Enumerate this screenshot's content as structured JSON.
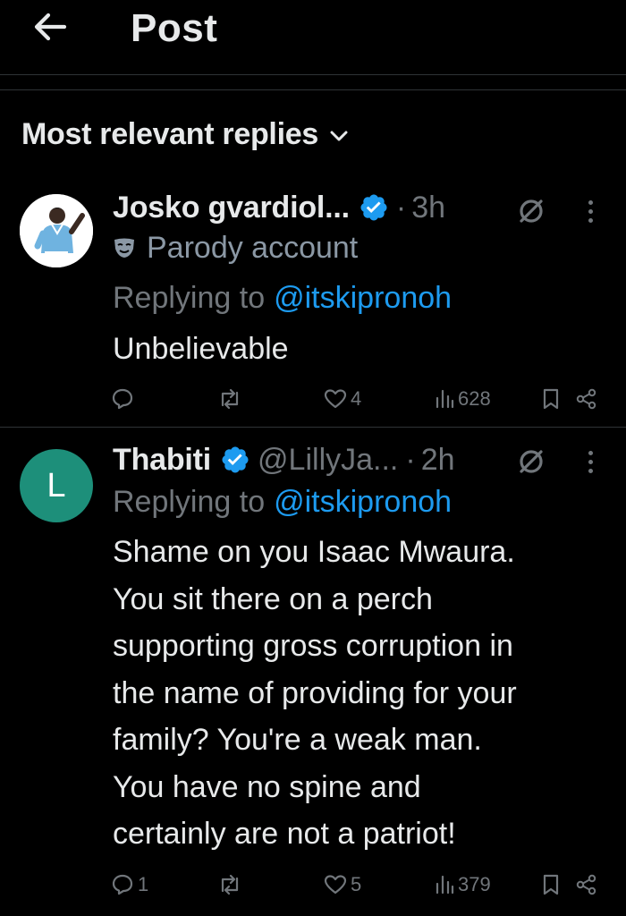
{
  "header": {
    "title": "Post"
  },
  "sort": {
    "label": "Most relevant replies"
  },
  "posts": [
    {
      "display_name": "Josko gvardiol...",
      "handle": "",
      "time": "3h",
      "parody_label": "Parody account",
      "replying_prefix": "Replying to",
      "replying_to": "@itskipronoh",
      "text": "Unbelievable",
      "replies": "",
      "likes": "4",
      "views": "628",
      "avatar_letter": ""
    },
    {
      "display_name": "Thabiti",
      "handle": "@LillyJa...",
      "time": "2h",
      "parody_label": "",
      "replying_prefix": "Replying to",
      "replying_to": "@itskipronoh",
      "text": "Shame on you Isaac Mwaura.\nYou sit there on a perch\nsupporting gross corruption in\nthe name of providing for your\nfamily? You're a weak man.\nYou have no spine and\ncertainly are not a patriot!",
      "replies": "1",
      "likes": "5",
      "views": "379",
      "avatar_letter": "L"
    }
  ],
  "colors": {
    "background": "#000000",
    "text": "#e7e9ea",
    "muted": "#71767b",
    "link": "#1d9bf0",
    "verified": "#1d9bf0",
    "divider": "#2f3336",
    "avatar_l": "#1d8f7a"
  },
  "icons": [
    "back-arrow-icon",
    "chevron-down-icon",
    "verified-badge-icon",
    "grok-icon",
    "more-icon",
    "parody-mask-icon",
    "reply-icon",
    "repost-icon",
    "like-icon",
    "views-icon",
    "bookmark-icon",
    "share-icon"
  ]
}
